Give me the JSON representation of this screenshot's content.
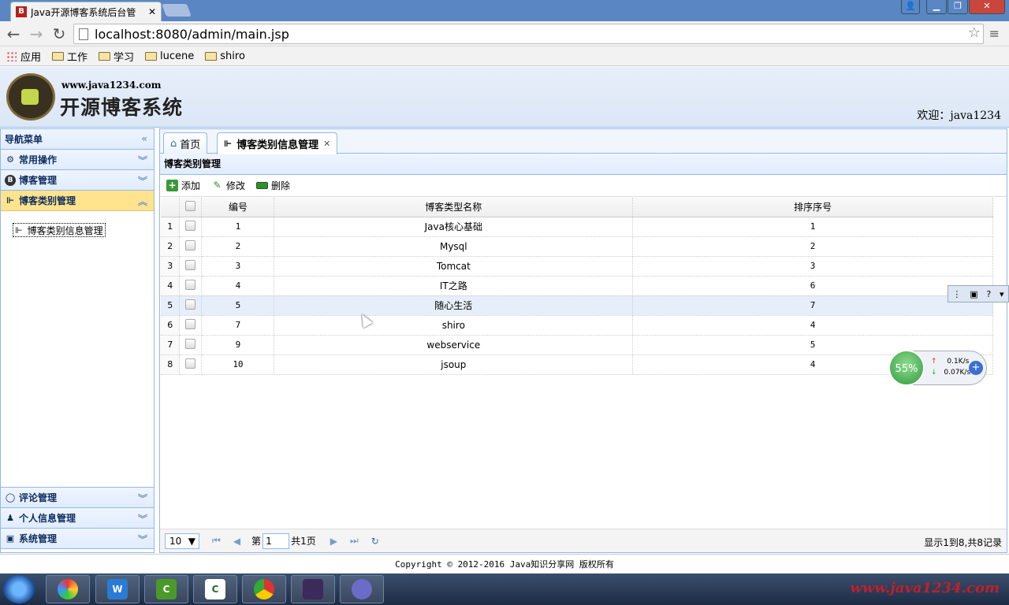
{
  "browser": {
    "tab_favicon": "B",
    "tab_title": "Java开源博客系统后台管",
    "url": "localhost:8080/admin/main.jsp",
    "bookmarks": [
      {
        "label": "应用",
        "icon": "apps-icon"
      },
      {
        "label": "工作",
        "icon": "folder-icon"
      },
      {
        "label": "学习",
        "icon": "folder-icon"
      },
      {
        "label": "lucene",
        "icon": "folder-icon"
      },
      {
        "label": "shiro",
        "icon": "folder-icon"
      }
    ]
  },
  "header": {
    "site_url": "www.java1234.com",
    "site_name": "开源博客系统",
    "welcome": "欢迎：java1234"
  },
  "west": {
    "title": "导航菜单",
    "panels": [
      {
        "label": "常用操作",
        "icon": "gear-icon"
      },
      {
        "label": "博客管理",
        "icon": "blog-icon"
      },
      {
        "label": "博客类别管理",
        "icon": "tree-icon"
      },
      {
        "label": "评论管理",
        "icon": "comment-icon"
      },
      {
        "label": "个人信息管理",
        "icon": "user-icon"
      },
      {
        "label": "系统管理",
        "icon": "system-icon"
      }
    ],
    "tree_item": "博客类别信息管理"
  },
  "center": {
    "tabs": [
      {
        "label": "首页",
        "icon": "home-icon"
      },
      {
        "label": "博客类别信息管理",
        "icon": "tree-icon",
        "closable": true
      }
    ],
    "panel_title": "博客类别管理",
    "toolbar": {
      "add": "添加",
      "edit": "修改",
      "delete": "删除"
    },
    "columns": [
      "编号",
      "博客类型名称",
      "排序序号"
    ],
    "rows": [
      {
        "rn": "1",
        "id": "1",
        "name": "Java核心基础",
        "order": "1"
      },
      {
        "rn": "2",
        "id": "2",
        "name": "Mysql",
        "order": "2"
      },
      {
        "rn": "3",
        "id": "3",
        "name": "Tomcat",
        "order": "3"
      },
      {
        "rn": "4",
        "id": "4",
        "name": "IT之路",
        "order": "6"
      },
      {
        "rn": "5",
        "id": "5",
        "name": "随心生活",
        "order": "7"
      },
      {
        "rn": "6",
        "id": "7",
        "name": "shiro",
        "order": "4"
      },
      {
        "rn": "7",
        "id": "9",
        "name": "webservice",
        "order": "5"
      },
      {
        "rn": "8",
        "id": "10",
        "name": "jsoup",
        "order": "4"
      }
    ],
    "pager": {
      "page_size": "10",
      "page_prefix": "第",
      "page_value": "1",
      "page_suffix": "共1页",
      "info": "显示1到8,共8记录"
    }
  },
  "footer": "Copyright © 2012-2016 Java知识分享网 版权所有",
  "widgets": {
    "net_percent": "55%",
    "net_up": "0.1K/s",
    "net_down": "0.07K/s"
  },
  "taskbar": {
    "watermark": "www.java1234.com"
  },
  "colors": {
    "accent": "#95b8e7",
    "selected_panel": "#ffe48d",
    "row_hover": "#e6eefa"
  }
}
